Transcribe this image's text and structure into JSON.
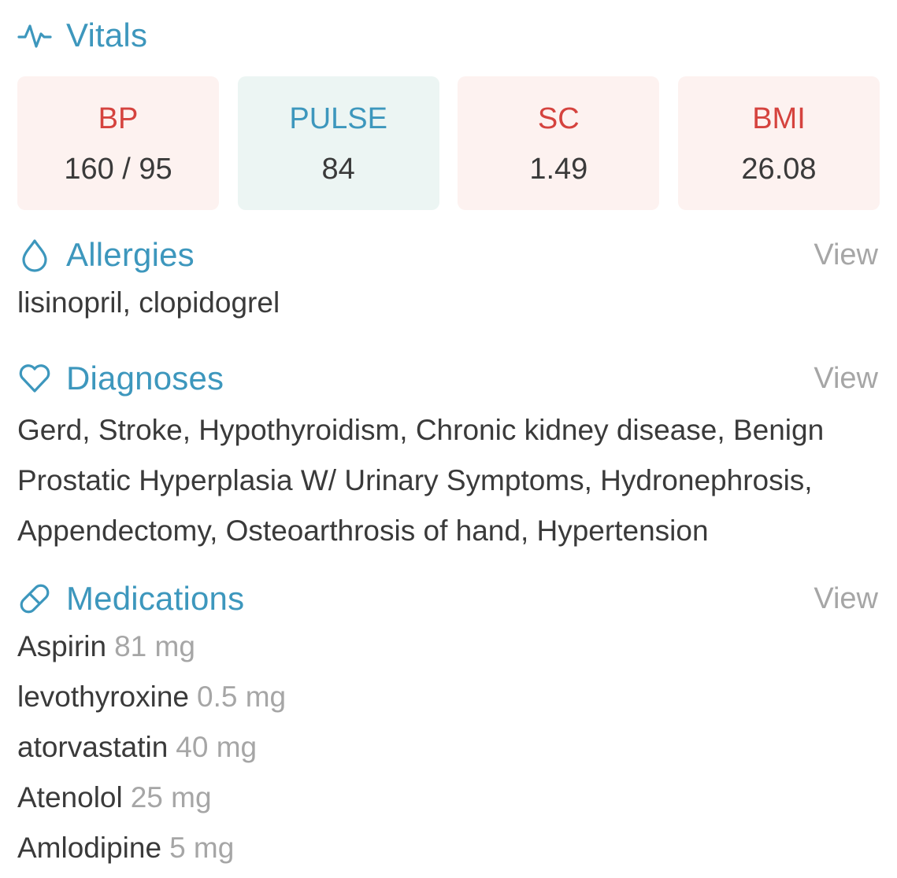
{
  "vitals": {
    "title": "Vitals",
    "icon": "activity-pulse-icon",
    "cards": [
      {
        "label": "BP",
        "value": "160 / 95",
        "status": "alert"
      },
      {
        "label": "PULSE",
        "value": "84",
        "status": "normal"
      },
      {
        "label": "SC",
        "value": "1.49",
        "status": "alert"
      },
      {
        "label": "BMI",
        "value": "26.08",
        "status": "alert"
      }
    ]
  },
  "allergies": {
    "title": "Allergies",
    "icon": "droplet-icon",
    "view_label": "View",
    "text": "lisinopril, clopidogrel"
  },
  "diagnoses": {
    "title": "Diagnoses",
    "icon": "heart-icon",
    "view_label": "View",
    "text": "Gerd, Stroke, Hypothyroidism, Chronic kidney disease, Benign Prostatic Hyperplasia W/ Urinary Symptoms, Hydronephrosis, Appendectomy, Osteoarthrosis of hand, Hypertension"
  },
  "medications": {
    "title": "Medications",
    "icon": "pill-icon",
    "view_label": "View",
    "items": [
      {
        "name": "Aspirin",
        "dose": "81 mg"
      },
      {
        "name": "levothyroxine",
        "dose": "0.5 mg"
      },
      {
        "name": "atorvastatin",
        "dose": "40 mg"
      },
      {
        "name": "Atenolol",
        "dose": "25 mg"
      },
      {
        "name": "Amlodipine",
        "dose": "5 mg"
      }
    ]
  },
  "colors": {
    "accent": "#3d97bd",
    "alert_text": "#d5433e",
    "alert_bg": "#fdf2f0",
    "normal_bg": "#ecf5f3",
    "muted": "#a6a6a6",
    "body_text": "#3a3a3a"
  }
}
